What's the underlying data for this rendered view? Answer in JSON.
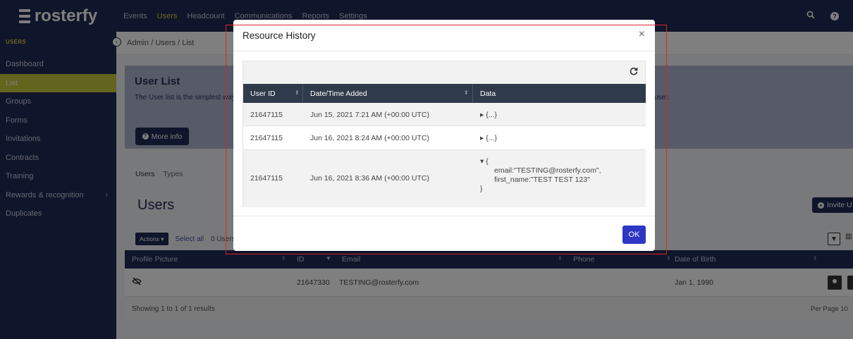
{
  "topnav": {
    "logo": "rosterfy",
    "links": [
      "Events",
      "Users",
      "Headcount",
      "Communications",
      "Reports",
      "Settings"
    ],
    "active_index": 1
  },
  "sidebar": {
    "heading": "USERS",
    "items": [
      "Dashboard",
      "List",
      "Groups",
      "Forms",
      "Invitations",
      "Contracts",
      "Training",
      "Rewards & recognition",
      "Duplicates"
    ],
    "active_index": 1
  },
  "breadcrumb": "Admin / Users / List",
  "hero": {
    "title": "User List",
    "description": "The User list is the simplest way to view all users, with the ability to search, filter, exporting and sorting. You can view further details and in-depth information about the user.",
    "more_info": "More info"
  },
  "tabs": [
    "Users",
    "Types"
  ],
  "users_title": "Users",
  "invite_label": "Invite U",
  "actions": {
    "button": "Actions",
    "select_all": "Select all",
    "selected": "0 Users"
  },
  "table": {
    "headers": [
      "Profile Picture",
      "ID",
      "Email",
      "Phone",
      "Date of Birth"
    ],
    "rows": [
      {
        "id": "21647330",
        "email": "TESTING@rosterfy.com",
        "phone": "",
        "dob": "Jan 1, 1990"
      }
    ],
    "footer": "Showing 1 to 1 of 1 results",
    "per_page": "Per Page 10"
  },
  "modal": {
    "title": "Resource History",
    "close": "×",
    "headers": [
      "User ID",
      "Date/Time Added",
      "Data"
    ],
    "rows": [
      {
        "user_id": "21647115",
        "datetime": "Jun 15, 2021 7:21 AM (+00:00 UTC)",
        "data": "▸ {...}"
      },
      {
        "user_id": "21647115",
        "datetime": "Jun 16, 2021 8:24 AM (+00:00 UTC)",
        "data": "▸ {...}"
      },
      {
        "user_id": "21647115",
        "datetime": "Jun 16, 2021 8:36 AM (+00:00 UTC)",
        "data_open": "▾ {",
        "data_lines": [
          "email:\"TESTING@rosterfy.com\",",
          "first_name:\"TEST TEST 123\""
        ],
        "data_close": "}"
      }
    ],
    "ok": "OK"
  },
  "colors": {
    "nav": "#1f2b54",
    "accent": "#c7c93a",
    "active_link": "#e0c84a",
    "ok_button": "#2d37c4",
    "highlight_border": "#d9252c"
  }
}
